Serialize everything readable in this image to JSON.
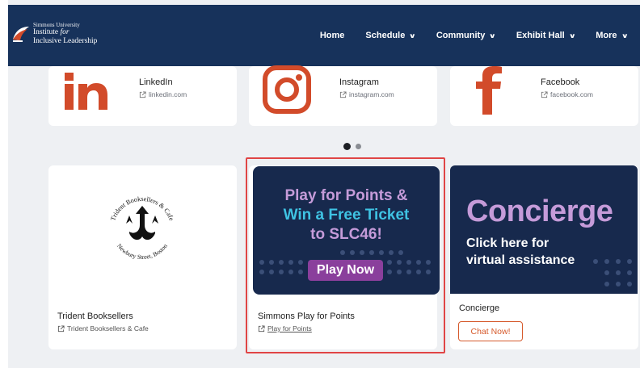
{
  "brand": {
    "line1": "Simmons University",
    "line2a": "Institute ",
    "line2b": "for",
    "line3": "Inclusive Leadership"
  },
  "nav": {
    "items": [
      {
        "label": "Home",
        "has_dropdown": false
      },
      {
        "label": "Schedule",
        "has_dropdown": true
      },
      {
        "label": "Community",
        "has_dropdown": true
      },
      {
        "label": "Exhibit Hall",
        "has_dropdown": true
      },
      {
        "label": "More",
        "has_dropdown": true
      }
    ],
    "chevron": "⌄"
  },
  "social": [
    {
      "label": "LinkedIn",
      "link": "linkedin.com",
      "icon": "linkedin-logo",
      "color": "#d24b2a"
    },
    {
      "label": "Instagram",
      "link": "instagram.com",
      "icon": "instagram-logo",
      "color": "#d24b2a"
    },
    {
      "label": "Facebook",
      "link": "facebook.com",
      "icon": "facebook-logo",
      "color": "#d24b2a"
    }
  ],
  "carousel": {
    "pages": 2,
    "active": 1
  },
  "exhibitors": [
    {
      "title": "Trident Booksellers",
      "link": "Trident Booksellers & Cafe",
      "logo": {
        "top": "Trident Booksellers & Cafe",
        "bottom": "Newbury Street, Boston"
      }
    },
    {
      "title": "Simmons Play for Points",
      "link": "Play for Points",
      "banner": {
        "line1": "Play for Points &",
        "line2": "Win a Free Ticket",
        "line3": "to SLC46!",
        "button": "Play Now"
      }
    },
    {
      "title": "Concierge",
      "banner": {
        "title": "Concierge",
        "sub1": "Click here for",
        "sub2": "virtual assistance"
      },
      "button": "Chat Now!"
    }
  ],
  "colors": {
    "header": "#17325b",
    "accent": "#d24b2a",
    "banner": "#17294d",
    "highlight": "#e04545"
  }
}
